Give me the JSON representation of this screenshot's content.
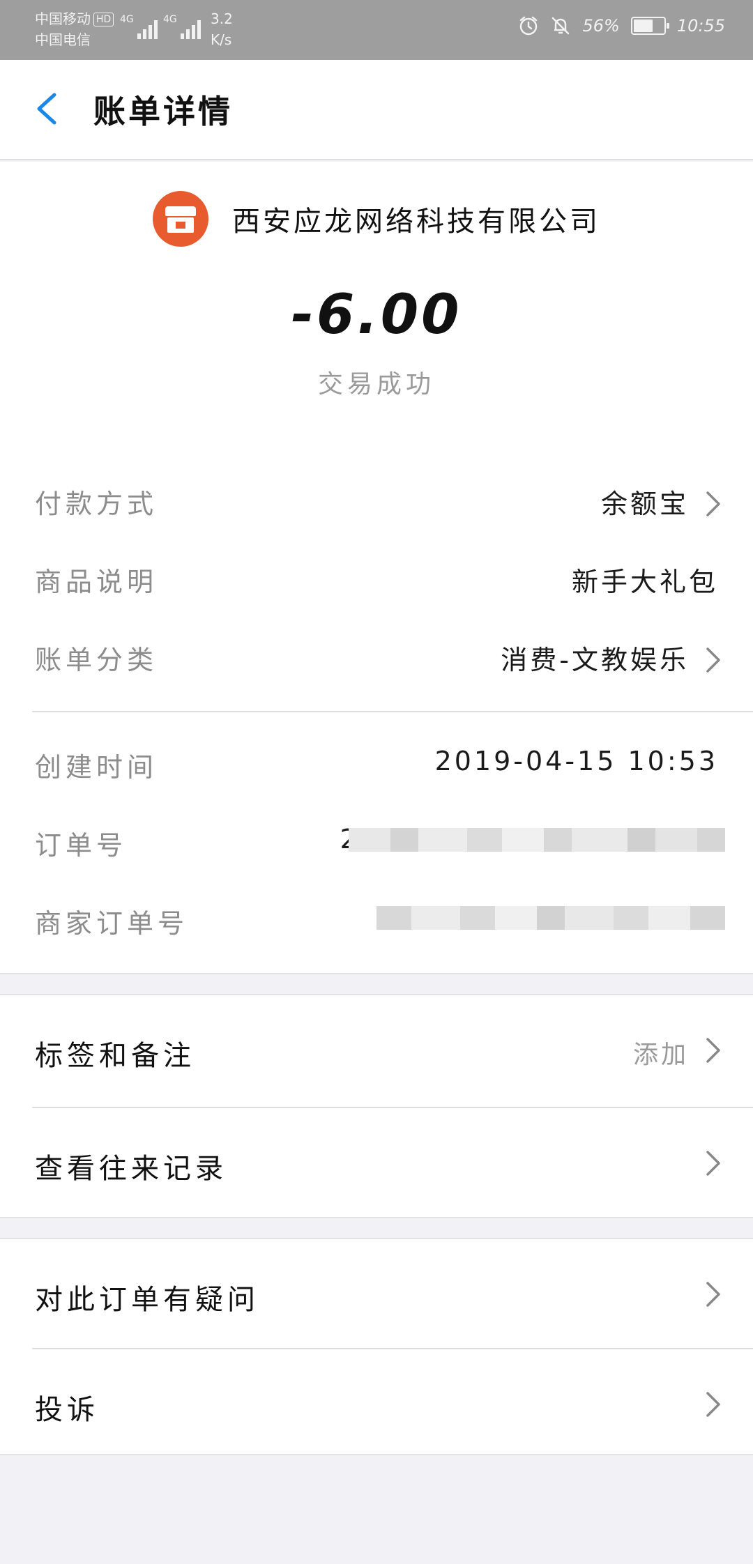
{
  "status_bar": {
    "carrier_1": "中国移动",
    "carrier_1_badge": "HD",
    "carrier_2": "中国电信",
    "network_1": "4G",
    "network_2": "4G",
    "speed_value": "3.2",
    "speed_unit": "K/s",
    "battery": "56%",
    "time": "10:55",
    "battery_level": 0.56
  },
  "nav": {
    "title": "账单详情"
  },
  "merchant": {
    "name": "西安应龙网络科技有限公司"
  },
  "amount": "-6.00",
  "trade_status": "交易成功",
  "details": [
    {
      "label": "付款方式",
      "value": "余额宝"
    },
    {
      "label": "商品说明",
      "value": "新手大礼包"
    },
    {
      "label": "账单分类",
      "value": "消费-文教娱乐"
    }
  ],
  "order_info": [
    {
      "label": "创建时间",
      "value": "2019-04-15 10:53"
    },
    {
      "label": "订单号",
      "value": "20"
    },
    {
      "label": "商家订单号",
      "value": ""
    }
  ],
  "actions": {
    "tags": {
      "label": "标签和备注",
      "value": "添加"
    },
    "history": {
      "label": "查看往来记录"
    },
    "question": {
      "label": "对此订单有疑问"
    },
    "complaint": {
      "label": "投诉"
    }
  },
  "colors": {
    "accent": "#1a88e6",
    "merchant_icon": "#e75b2e",
    "status_bar": "#9e9e9e"
  }
}
